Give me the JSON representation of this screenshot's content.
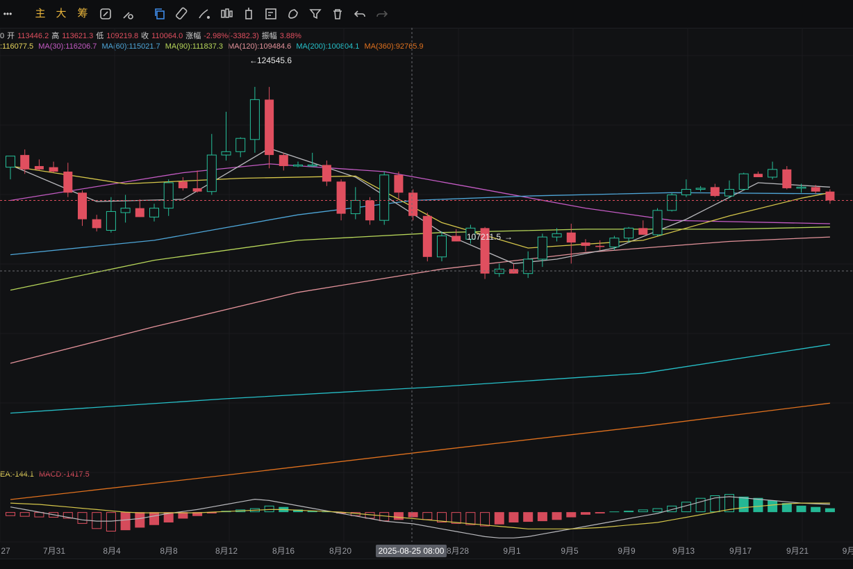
{
  "toolbar": {
    "more_label": "•••",
    "zhu": "主",
    "da": "大",
    "chou": "筹"
  },
  "ohlc": {
    "prefix": "0",
    "open_label": "开",
    "open": "113446.2",
    "high_label": "高",
    "high": "113621.3",
    "low_label": "低",
    "low": "109219.8",
    "close_label": "收",
    "close": "110064.0",
    "chg_label": "涨幅",
    "chg": "-2.98%(-3382.3)",
    "amp_label": "振幅",
    "amp": "3.88%"
  },
  "ma_legend": [
    {
      "text": ":116077.5",
      "color": "#e6d35c"
    },
    {
      "text": "MA(30):116206.7",
      "color": "#c45bc4"
    },
    {
      "text": "MA(60):115021.7",
      "color": "#4ea6d8"
    },
    {
      "text": "MA(90):111837.3",
      "color": "#b8d75a"
    },
    {
      "text": "MA(120):109484.6",
      "color": "#e4939b"
    },
    {
      "text": "MA(200):100804.1",
      "color": "#26c0c9"
    },
    {
      "text": "MA(360):92765.9",
      "color": "#e0711e"
    }
  ],
  "macd_legend": [
    {
      "text": "EA:-144.1",
      "color": "#e6d35c"
    },
    {
      "text": "MACD:-1417.5",
      "color": "#e04f5f"
    }
  ],
  "annotations": {
    "high": "124545.6",
    "low": "107211.5"
  },
  "crosshair_label": "2025-08-25 08:00",
  "colors": {
    "up": "#26c19b",
    "down": "#e04f5f",
    "background": "#111214"
  },
  "chart_data": {
    "type": "candlestick",
    "price_range": [
      91000,
      127500
    ],
    "x_labels": [
      "27",
      "7月31",
      "8月4",
      "8月8",
      "8月12",
      "8月16",
      "8月20",
      "8月28",
      "9月1",
      "9月5",
      "9月9",
      "9月13",
      "9月17",
      "9月21",
      "9月"
    ],
    "candles": [
      {
        "o": 117300,
        "h": 118000,
        "l": 116200,
        "c": 118300
      },
      {
        "o": 118400,
        "h": 118900,
        "l": 116700,
        "c": 117100
      },
      {
        "o": 117400,
        "h": 118000,
        "l": 117000,
        "c": 117100
      },
      {
        "o": 117300,
        "h": 117800,
        "l": 116800,
        "c": 116900
      },
      {
        "o": 116900,
        "h": 117700,
        "l": 114600,
        "c": 115000
      },
      {
        "o": 115000,
        "h": 115200,
        "l": 112000,
        "c": 112600
      },
      {
        "o": 112600,
        "h": 113000,
        "l": 111500,
        "c": 111800
      },
      {
        "o": 111600,
        "h": 114600,
        "l": 111400,
        "c": 113300
      },
      {
        "o": 113200,
        "h": 114800,
        "l": 112300,
        "c": 113600
      },
      {
        "o": 113600,
        "h": 114400,
        "l": 112800,
        "c": 112800
      },
      {
        "o": 112800,
        "h": 114000,
        "l": 112400,
        "c": 113600
      },
      {
        "o": 113600,
        "h": 116200,
        "l": 112900,
        "c": 115900
      },
      {
        "o": 116000,
        "h": 116400,
        "l": 115200,
        "c": 115400
      },
      {
        "o": 115400,
        "h": 117000,
        "l": 115000,
        "c": 115100
      },
      {
        "o": 115100,
        "h": 120300,
        "l": 114800,
        "c": 118400
      },
      {
        "o": 118400,
        "h": 122300,
        "l": 117900,
        "c": 118700
      },
      {
        "o": 118700,
        "h": 120000,
        "l": 118200,
        "c": 119900
      },
      {
        "o": 119800,
        "h": 124550,
        "l": 118600,
        "c": 123400
      },
      {
        "o": 123400,
        "h": 124545,
        "l": 117200,
        "c": 118400
      },
      {
        "o": 118400,
        "h": 118600,
        "l": 117000,
        "c": 117400
      },
      {
        "o": 117400,
        "h": 117800,
        "l": 117300,
        "c": 117500
      },
      {
        "o": 117500,
        "h": 118600,
        "l": 117300,
        "c": 117500
      },
      {
        "o": 117500,
        "h": 117900,
        "l": 115600,
        "c": 116000
      },
      {
        "o": 116000,
        "h": 116200,
        "l": 112500,
        "c": 113100
      },
      {
        "o": 113100,
        "h": 115500,
        "l": 112600,
        "c": 114300
      },
      {
        "o": 114300,
        "h": 114600,
        "l": 112100,
        "c": 112500
      },
      {
        "o": 112500,
        "h": 116900,
        "l": 112100,
        "c": 116600
      },
      {
        "o": 116600,
        "h": 116900,
        "l": 114400,
        "c": 115000
      },
      {
        "o": 115000,
        "h": 115300,
        "l": 112500,
        "c": 112900
      },
      {
        "o": 112900,
        "h": 113200,
        "l": 108800,
        "c": 109200
      },
      {
        "o": 109200,
        "h": 111500,
        "l": 108800,
        "c": 111100
      },
      {
        "o": 111100,
        "h": 111700,
        "l": 110600,
        "c": 110600
      },
      {
        "o": 110800,
        "h": 112100,
        "l": 110400,
        "c": 111800
      },
      {
        "o": 111800,
        "h": 111900,
        "l": 107211,
        "c": 107700
      },
      {
        "o": 107700,
        "h": 108600,
        "l": 107400,
        "c": 108100
      },
      {
        "o": 108100,
        "h": 108600,
        "l": 107700,
        "c": 107700
      },
      {
        "o": 107700,
        "h": 109700,
        "l": 107300,
        "c": 109000
      },
      {
        "o": 109000,
        "h": 111300,
        "l": 108300,
        "c": 111000
      },
      {
        "o": 111000,
        "h": 111800,
        "l": 110600,
        "c": 111300
      },
      {
        "o": 111400,
        "h": 112200,
        "l": 108600,
        "c": 110500
      },
      {
        "o": 110500,
        "h": 110800,
        "l": 109700,
        "c": 110200
      },
      {
        "o": 110200,
        "h": 110700,
        "l": 109800,
        "c": 110100
      },
      {
        "o": 110100,
        "h": 111100,
        "l": 109800,
        "c": 110900
      },
      {
        "o": 110900,
        "h": 111900,
        "l": 110500,
        "c": 111800
      },
      {
        "o": 111800,
        "h": 112500,
        "l": 111300,
        "c": 111200
      },
      {
        "o": 111200,
        "h": 113600,
        "l": 111100,
        "c": 113400
      },
      {
        "o": 113400,
        "h": 115000,
        "l": 113300,
        "c": 114800
      },
      {
        "o": 114800,
        "h": 116200,
        "l": 114600,
        "c": 115300
      },
      {
        "o": 115300,
        "h": 115600,
        "l": 115100,
        "c": 115400
      },
      {
        "o": 115500,
        "h": 115800,
        "l": 114600,
        "c": 114700
      },
      {
        "o": 114700,
        "h": 116100,
        "l": 114500,
        "c": 115300
      },
      {
        "o": 115300,
        "h": 116800,
        "l": 115200,
        "c": 116700
      },
      {
        "o": 116700,
        "h": 116900,
        "l": 116400,
        "c": 116400
      },
      {
        "o": 116400,
        "h": 117800,
        "l": 116200,
        "c": 117100
      },
      {
        "o": 117100,
        "h": 117400,
        "l": 115300,
        "c": 115400
      },
      {
        "o": 115400,
        "h": 115800,
        "l": 115000,
        "c": 115500
      },
      {
        "o": 115500,
        "h": 115700,
        "l": 114900,
        "c": 115100
      },
      {
        "o": 115100,
        "h": 115300,
        "l": 114000,
        "c": 114300
      }
    ],
    "ma_series": [
      {
        "name": "MA(30)",
        "color": "#c45bc4",
        "points": [
          [
            0,
            114300
          ],
          [
            12,
            116800
          ],
          [
            18,
            117600
          ],
          [
            26,
            116900
          ],
          [
            32,
            115500
          ],
          [
            40,
            113600
          ],
          [
            46,
            112500
          ],
          [
            57,
            112200
          ]
        ]
      },
      {
        "name": "MA(60)",
        "color": "#4ea6d8",
        "points": [
          [
            0,
            109400
          ],
          [
            10,
            110700
          ],
          [
            20,
            113000
          ],
          [
            28,
            114300
          ],
          [
            36,
            114700
          ],
          [
            46,
            115000
          ],
          [
            57,
            114900
          ]
        ]
      },
      {
        "name": "MA(90)",
        "color": "#b8d75a",
        "points": [
          [
            0,
            106200
          ],
          [
            10,
            108900
          ],
          [
            20,
            110700
          ],
          [
            30,
            111400
          ],
          [
            40,
            111700
          ],
          [
            50,
            111700
          ],
          [
            57,
            111900
          ]
        ]
      },
      {
        "name": "MA(120)",
        "color": "#e4939b",
        "points": [
          [
            0,
            99600
          ],
          [
            10,
            102900
          ],
          [
            20,
            106000
          ],
          [
            30,
            108100
          ],
          [
            40,
            109600
          ],
          [
            50,
            110600
          ],
          [
            57,
            111000
          ]
        ]
      },
      {
        "name": "MA(200)",
        "color": "#26c0c9",
        "points": [
          [
            0,
            95100
          ],
          [
            15,
            96400
          ],
          [
            30,
            97500
          ],
          [
            44,
            98700
          ],
          [
            57,
            101300
          ]
        ]
      },
      {
        "name": "MA(360)",
        "color": "#e0711e",
        "points": [
          [
            0,
            87300
          ],
          [
            15,
            89500
          ],
          [
            30,
            91800
          ],
          [
            44,
            93900
          ],
          [
            57,
            96000
          ]
        ]
      },
      {
        "name": "short-white",
        "color": "#b9b9bd",
        "points": [
          [
            0,
            117500
          ],
          [
            6,
            114200
          ],
          [
            12,
            114400
          ],
          [
            18,
            119000
          ],
          [
            24,
            116400
          ],
          [
            30,
            111400
          ],
          [
            35,
            108600
          ],
          [
            38,
            109000
          ],
          [
            42,
            110000
          ],
          [
            47,
            112600
          ],
          [
            52,
            115900
          ],
          [
            57,
            115500
          ]
        ]
      },
      {
        "name": "short-yellow",
        "color": "#d5c64a",
        "points": [
          [
            0,
            117400
          ],
          [
            8,
            115800
          ],
          [
            16,
            116300
          ],
          [
            24,
            116500
          ],
          [
            30,
            112300
          ],
          [
            36,
            110000
          ],
          [
            44,
            110700
          ],
          [
            50,
            112900
          ],
          [
            55,
            114500
          ],
          [
            57,
            115000
          ]
        ]
      }
    ],
    "macd": {
      "range": [
        -2200,
        2000
      ],
      "hist": [
        -300,
        -350,
        -400,
        -420,
        -500,
        -900,
        -1300,
        -1500,
        -1400,
        -1200,
        -1000,
        -800,
        -500,
        -300,
        -100,
        100,
        200,
        300,
        500,
        400,
        200,
        100,
        50,
        -100,
        -300,
        -500,
        -700,
        -600,
        -400,
        -600,
        -800,
        -900,
        -1000,
        -1100,
        -950,
        -800,
        -750,
        -700,
        -600,
        -400,
        -200,
        -100,
        50,
        100,
        200,
        300,
        500,
        800,
        1100,
        1300,
        1400,
        1200,
        1100,
        900,
        700,
        500,
        400,
        300
      ],
      "dif": [
        400,
        200,
        0,
        -200,
        -400,
        -600,
        -700,
        -700,
        -600,
        -500,
        -300,
        -100,
        50,
        200,
        400,
        600,
        800,
        1000,
        900,
        700,
        500,
        300,
        100,
        -100,
        -300,
        -500,
        -700,
        -800,
        -900,
        -1100,
        -1300,
        -1500,
        -1700,
        -1900,
        -2000,
        -2000,
        -1900,
        -1700,
        -1500,
        -1300,
        -1100,
        -900,
        -700,
        -500,
        -300,
        -100,
        200,
        500,
        800,
        1100,
        1200,
        1100,
        1000,
        900,
        800,
        700,
        650,
        600
      ],
      "dea": [
        700,
        650,
        600,
        500,
        400,
        300,
        200,
        100,
        0,
        -50,
        -50,
        -50,
        -50,
        -50,
        0,
        50,
        100,
        150,
        200,
        200,
        150,
        100,
        50,
        0,
        -100,
        -200,
        -300,
        -400,
        -500,
        -600,
        -700,
        -800,
        -900,
        -1000,
        -1100,
        -1200,
        -1300,
        -1300,
        -1300,
        -1300,
        -1250,
        -1200,
        -1100,
        -1000,
        -900,
        -800,
        -600,
        -400,
        -200,
        0,
        200,
        350,
        450,
        550,
        650,
        700,
        700,
        700
      ]
    }
  }
}
